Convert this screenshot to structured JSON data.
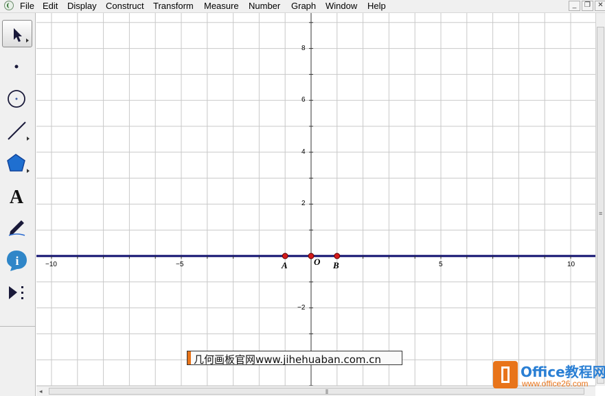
{
  "menubar": {
    "items": [
      "File",
      "Edit",
      "Display",
      "Construct",
      "Transform",
      "Measure",
      "Number",
      "Graph",
      "Window",
      "Help"
    ],
    "window_buttons": {
      "minimize": "_",
      "restore": "❐",
      "close": "✕"
    }
  },
  "toolbox": {
    "tools": [
      {
        "name": "arrow-tool",
        "icon": "pointer-arrow-icon",
        "active": true
      },
      {
        "name": "point-tool",
        "icon": "point-icon"
      },
      {
        "name": "compass-tool",
        "icon": "circle-icon"
      },
      {
        "name": "straightedge-tool",
        "icon": "segment-icon"
      },
      {
        "name": "polygon-tool",
        "icon": "polygon-icon"
      },
      {
        "name": "text-tool",
        "icon": "text-A-icon",
        "label": "A"
      },
      {
        "name": "marker-tool",
        "icon": "pen-icon"
      },
      {
        "name": "information-tool",
        "icon": "info-icon",
        "label": "i"
      },
      {
        "name": "custom-tool",
        "icon": "play-more-icon"
      }
    ]
  },
  "graph": {
    "x_ticks": [
      "−10",
      "−5",
      "5",
      "10"
    ],
    "y_ticks": [
      "8",
      "6",
      "4",
      "2",
      "−2"
    ],
    "points": [
      {
        "label": "A",
        "x": -1
      },
      {
        "label": "O",
        "x": 0
      },
      {
        "label": "B",
        "x": 1
      }
    ],
    "line_color": "#0d0d6e",
    "point_color": "#d41c1c",
    "grid_color": "#c8c8c8"
  },
  "caption": {
    "text": "几何画板官网www.jihehuaban.com.cn"
  },
  "office_logo": {
    "title": "Office教程网",
    "url": "www.office26.com"
  },
  "scrollbar": {
    "grip": "≡"
  }
}
